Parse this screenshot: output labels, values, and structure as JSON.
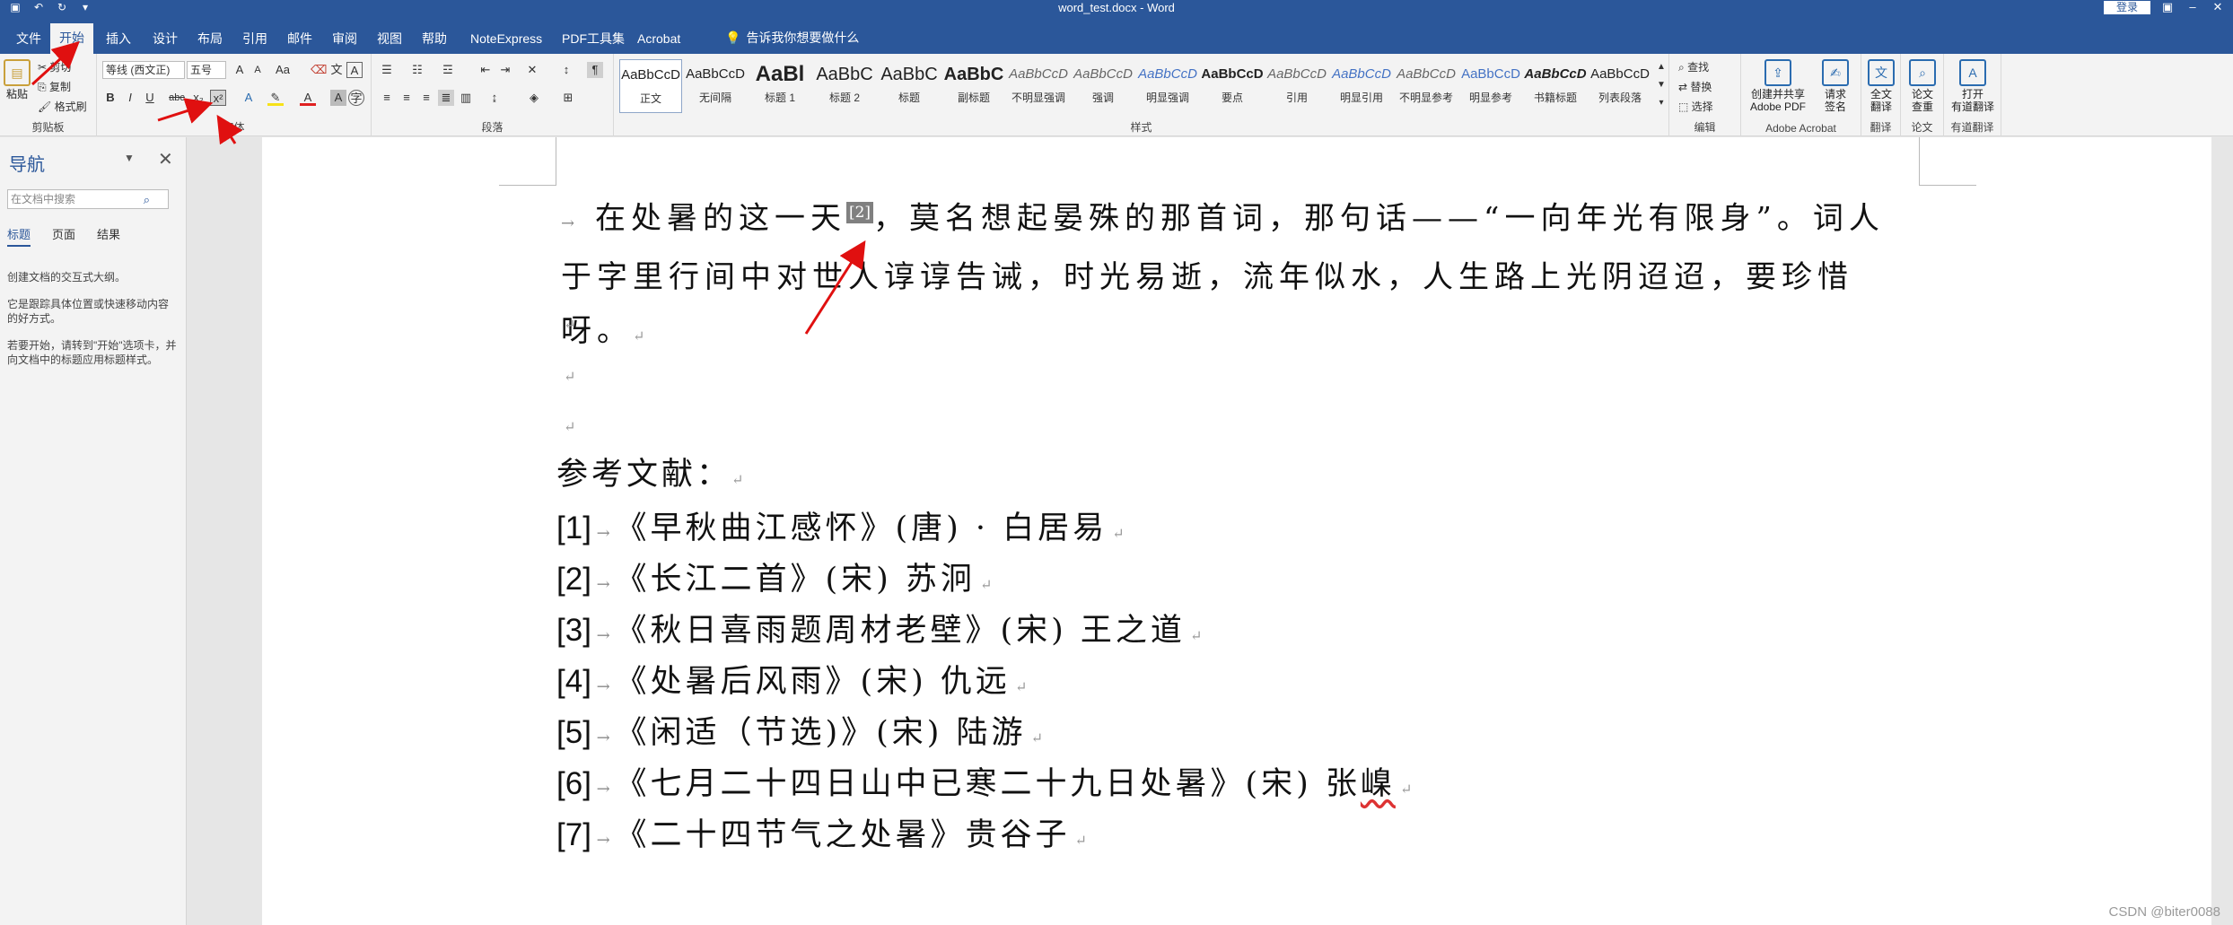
{
  "window": {
    "title": "word_test.docx  -  Word",
    "login_label": "登录"
  },
  "tabs": [
    "文件",
    "开始",
    "插入",
    "设计",
    "布局",
    "引用",
    "邮件",
    "审阅",
    "视图",
    "帮助",
    "NoteExpress",
    "PDF工具集",
    "Acrobat"
  ],
  "tell_me": "告诉我你想要做什么",
  "ribbon": {
    "clipboard": {
      "paste": "粘贴",
      "cut": "剪切",
      "copy": "复制",
      "format_painter": "格式刷",
      "label": "剪贴板"
    },
    "font": {
      "font_name": "等线 (西文正)",
      "font_size": "五号",
      "label": "字体"
    },
    "paragraph": {
      "label": "段落"
    },
    "styles": {
      "label": "样式",
      "items": [
        {
          "sample": "AaBbCcD",
          "name": "正文"
        },
        {
          "sample": "AaBbCcD",
          "name": "无间隔"
        },
        {
          "sample": "AaBl",
          "name": "标题 1"
        },
        {
          "sample": "AaBbC",
          "name": "标题 2"
        },
        {
          "sample": "AaBbC",
          "name": "标题"
        },
        {
          "sample": "AaBbC",
          "name": "副标题"
        },
        {
          "sample": "AaBbCcD",
          "name": "不明显强调"
        },
        {
          "sample": "AaBbCcD",
          "name": "强调"
        },
        {
          "sample": "AaBbCcD",
          "name": "明显强调"
        },
        {
          "sample": "AaBbCcD",
          "name": "要点"
        },
        {
          "sample": "AaBbCcD",
          "name": "引用"
        },
        {
          "sample": "AaBbCcD",
          "name": "明显引用"
        },
        {
          "sample": "AaBbCcD",
          "name": "不明显参考"
        },
        {
          "sample": "AaBbCcD",
          "name": "明显参考"
        },
        {
          "sample": "AaBbCcD",
          "name": "书籍标题"
        },
        {
          "sample": "AaBbCcD",
          "name": "列表段落"
        }
      ]
    },
    "editing": {
      "find": "查找",
      "replace": "替换",
      "select": "选择",
      "label": "编辑"
    },
    "acrobat": {
      "create_share": "创建并共享",
      "create_share2": "Adobe PDF",
      "request": "请求",
      "request2": "签名",
      "label": "Adobe Acrobat"
    },
    "translate": {
      "full": "全文",
      "full2": "翻译",
      "label": "翻译"
    },
    "paper": {
      "check": "论文",
      "check2": "查重",
      "label": "论文"
    },
    "youdao": {
      "open": "打开",
      "open2": "有道翻译",
      "label": "有道翻译"
    }
  },
  "nav": {
    "title": "导航",
    "search_placeholder": "在文档中搜索",
    "tabs": [
      "标题",
      "页面",
      "结果"
    ],
    "hint1": "创建文档的交互式大纲。",
    "hint2": "它是跟踪具体位置或快速移动内容的好方式。",
    "hint3": "若要开始，请转到\"开始\"选项卡，并向文档中的标题应用标题样式。"
  },
  "document": {
    "para_part1": "在处暑的这一天",
    "footnote_ref": "[2]",
    "para_part2": "，莫名想起晏殊的那首词，那句话——“一向年光有限身”。词人于字里行间中对世人谆谆告诫，时光易逝，流年似水，人生路上光阴迢迢，要珍惜呀。",
    "heading": "参考文献：",
    "references": [
      {
        "num": "[1]",
        "text": "《早秋曲江感怀》(唐) · 白居易"
      },
      {
        "num": "[2]",
        "text": "《长江二首》(宋) 苏泂"
      },
      {
        "num": "[3]",
        "text": "《秋日喜雨题周材老壁》(宋) 王之道"
      },
      {
        "num": "[4]",
        "text": "《处暑后风雨》(宋) 仇远"
      },
      {
        "num": "[5]",
        "text": "《闲适（节选)》(宋) 陆游"
      },
      {
        "num": "[6]",
        "text": "《七月二十四日山中已寒二十九日处暑》(宋) 张"
      },
      {
        "num": "[7]",
        "text": "《二十四节气之处暑》贵谷子"
      }
    ],
    "ref6_tail": "嵲"
  },
  "watermark": "CSDN @biter0088"
}
